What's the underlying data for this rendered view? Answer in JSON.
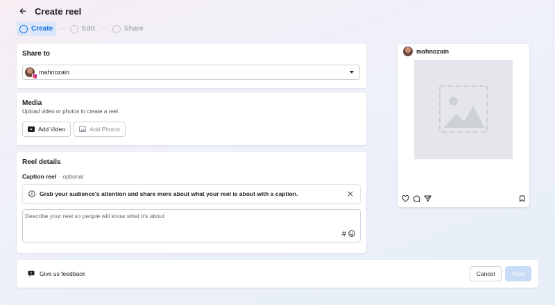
{
  "header": {
    "title": "Create reel"
  },
  "steps": [
    {
      "label": "Create",
      "active": true
    },
    {
      "label": "Edit",
      "active": false
    },
    {
      "label": "Share",
      "active": false
    }
  ],
  "share": {
    "title": "Share to",
    "account": "mahnozain"
  },
  "media": {
    "title": "Media",
    "subtitle": "Upload video or photos to create a reel.",
    "add_video": "Add Video",
    "add_photos": "Add Photos"
  },
  "details": {
    "title": "Reel details",
    "caption_label": "Caption reel",
    "caption_optional": "· optional",
    "banner": "Grab your audience's attention and share more about what your reel is about with a caption.",
    "caption_placeholder": "Describe your reel so people will know what it's about",
    "hashtag": "#"
  },
  "preview": {
    "account": "mahnozain"
  },
  "footer": {
    "feedback": "Give us feedback",
    "cancel": "Cancel",
    "next": "Next"
  },
  "colors": {
    "accent": "#1b74e4",
    "next_disabled": "#c9dcf5",
    "placeholder_bg": "#e4e6eb"
  }
}
